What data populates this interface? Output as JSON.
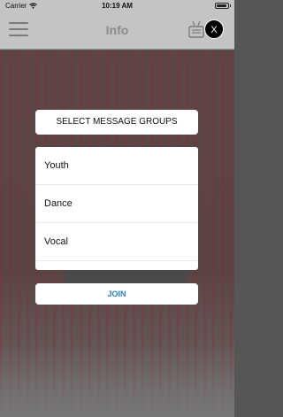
{
  "status_bar": {
    "carrier": "Carrier",
    "time": "10:19 AM"
  },
  "nav": {
    "title": "Info",
    "close_label": "X"
  },
  "dialog": {
    "title": "SELECT MESSAGE GROUPS",
    "groups": [
      {
        "label": "Youth"
      },
      {
        "label": "Dance"
      },
      {
        "label": "Vocal"
      }
    ],
    "join_label": "JOIN"
  }
}
